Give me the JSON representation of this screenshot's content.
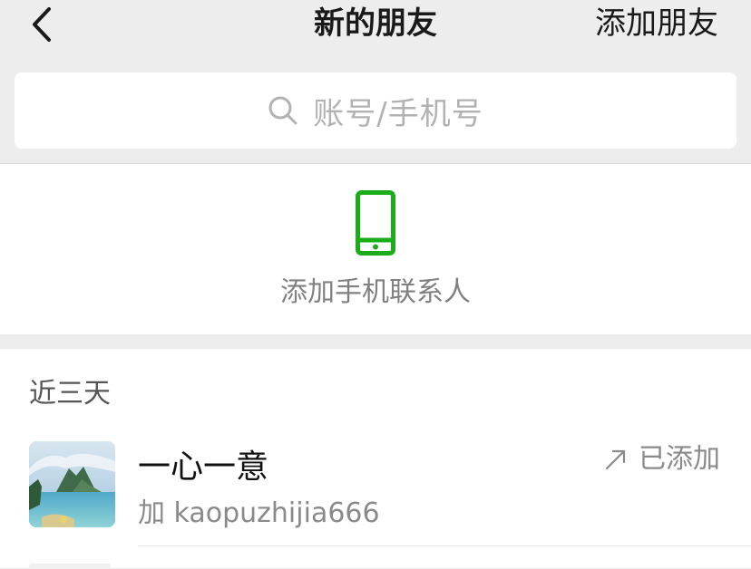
{
  "header": {
    "title": "新的朋友",
    "action_label": "添加朋友",
    "back_icon": "chevron-left-icon"
  },
  "search": {
    "placeholder": "账号/手机号",
    "icon": "search-icon"
  },
  "add_phone_contacts": {
    "label": "添加手机联系人",
    "icon": "mobile-phone-icon",
    "icon_color": "#1aad19"
  },
  "recent": {
    "section_title": "近三天",
    "items": [
      {
        "name": "一心一意",
        "subtitle": "加 kaopuzhijia666",
        "status": "已添加",
        "status_icon": "arrow-up-right-icon",
        "avatar": "landscape-avatar"
      }
    ]
  },
  "colors": {
    "background": "#ededed",
    "card": "#ffffff",
    "accent_green": "#1aad19",
    "secondary_text": "#8a8a8a"
  }
}
